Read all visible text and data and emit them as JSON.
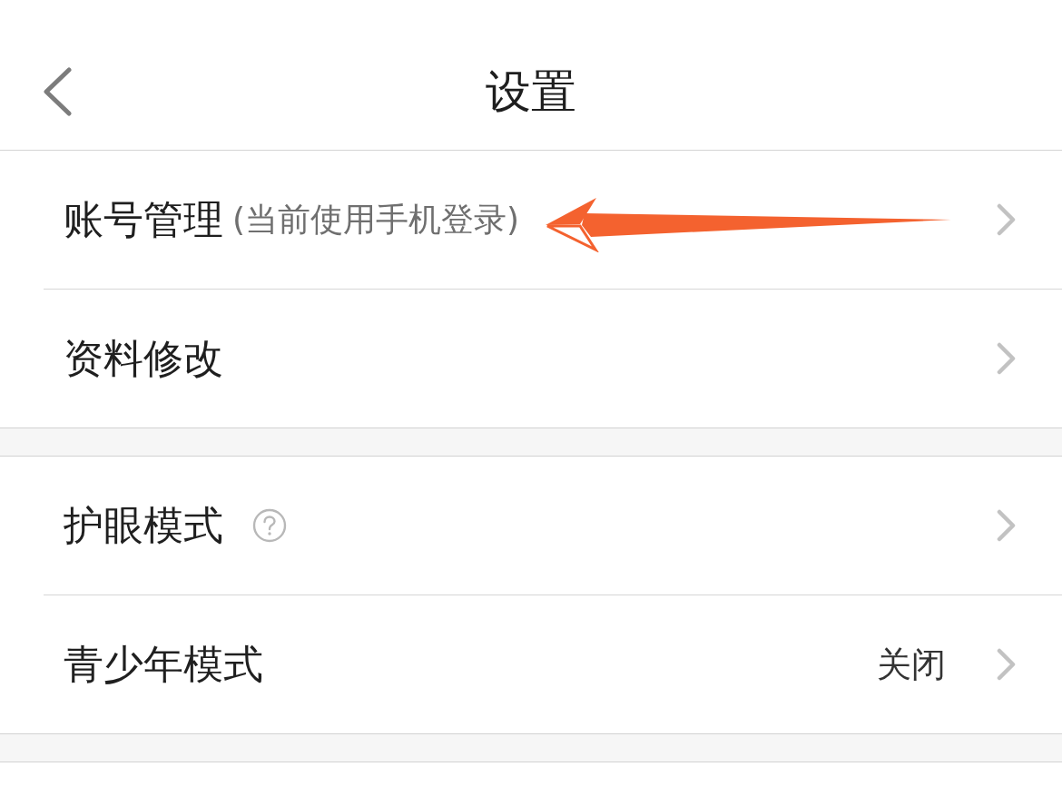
{
  "header": {
    "title": "设置"
  },
  "groups": [
    {
      "items": [
        {
          "label": "账号管理",
          "note": "(当前使用手机登录)",
          "arrow": true
        },
        {
          "label": "资料修改"
        }
      ]
    },
    {
      "items": [
        {
          "label": "护眼模式",
          "help": true
        },
        {
          "label": "青少年模式",
          "value": "关闭"
        }
      ]
    }
  ]
}
